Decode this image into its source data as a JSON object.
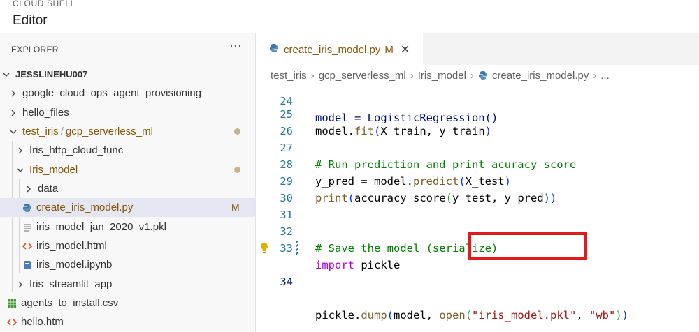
{
  "header": {
    "kicker": "CLOUD SHELL",
    "title": "Editor"
  },
  "explorer": {
    "title": "EXPLORER",
    "more": "···",
    "root": "JESSLINEHU007",
    "items": [
      {
        "label": "google_cloud_ops_agent_provisioning"
      },
      {
        "label": "hello_files"
      },
      {
        "label_a": "test_iris",
        "sep": "/",
        "label_b": "gcp_serverless_ml"
      },
      {
        "label": "Iris_http_cloud_func"
      },
      {
        "label": "Iris_model"
      },
      {
        "label": "data"
      },
      {
        "label": "create_iris_model.py",
        "badge": "M"
      },
      {
        "label": "iris_model_jan_2020_v1.pkl"
      },
      {
        "label": "iris_model.html"
      },
      {
        "label": "iris_model.ipynb"
      },
      {
        "label": "Iris_streamlit_app"
      },
      {
        "label": "agents_to_install.csv"
      },
      {
        "label": "hello.htm"
      }
    ]
  },
  "tab": {
    "label": "create_iris_model.py",
    "badge": "M",
    "close": "✕"
  },
  "breadcrumb": [
    "test_iris",
    "gcp_serverless_ml",
    "Iris_model",
    "create_iris_model.py",
    "..."
  ],
  "code": {
    "lines": [
      {
        "num": "24",
        "text": "model = LogisticRegression()"
      },
      {
        "num": "25",
        "a": "model",
        "b": ".",
        "c": "fit",
        "d": "(",
        "e": "X_train, y_train",
        "f": ")"
      },
      {
        "num": "26"
      },
      {
        "num": "27",
        "text": "# Run prediction and print acuracy score"
      },
      {
        "num": "28",
        "a": "y_pred",
        "b": " = model.",
        "c": "predict",
        "d": "(",
        "e": "X_test",
        "f": ")"
      },
      {
        "num": "29",
        "a": "print",
        "b": "(",
        "c": "accuracy_score",
        "d": "(",
        "e": "y_test, y_pred",
        "f": "))"
      },
      {
        "num": "30"
      },
      {
        "num": "31"
      },
      {
        "num": "32",
        "text": "# Save the model (serialize)"
      },
      {
        "num": "33",
        "kw": "import",
        "rest": " pickle"
      },
      {
        "num": "34",
        "a": "pickle",
        "b": ".",
        "c": "dump",
        "d": "(",
        "e": "model, ",
        "f": "open",
        "g": "(",
        "h": "\"iris_model.pkl\"",
        "i": ", ",
        "j": "\"wb\"",
        "k": ")",
        "l": ")"
      }
    ]
  },
  "colors": {
    "modified": "#895503",
    "highlight": "#e11b1b",
    "selection": "#e4e6f1"
  }
}
